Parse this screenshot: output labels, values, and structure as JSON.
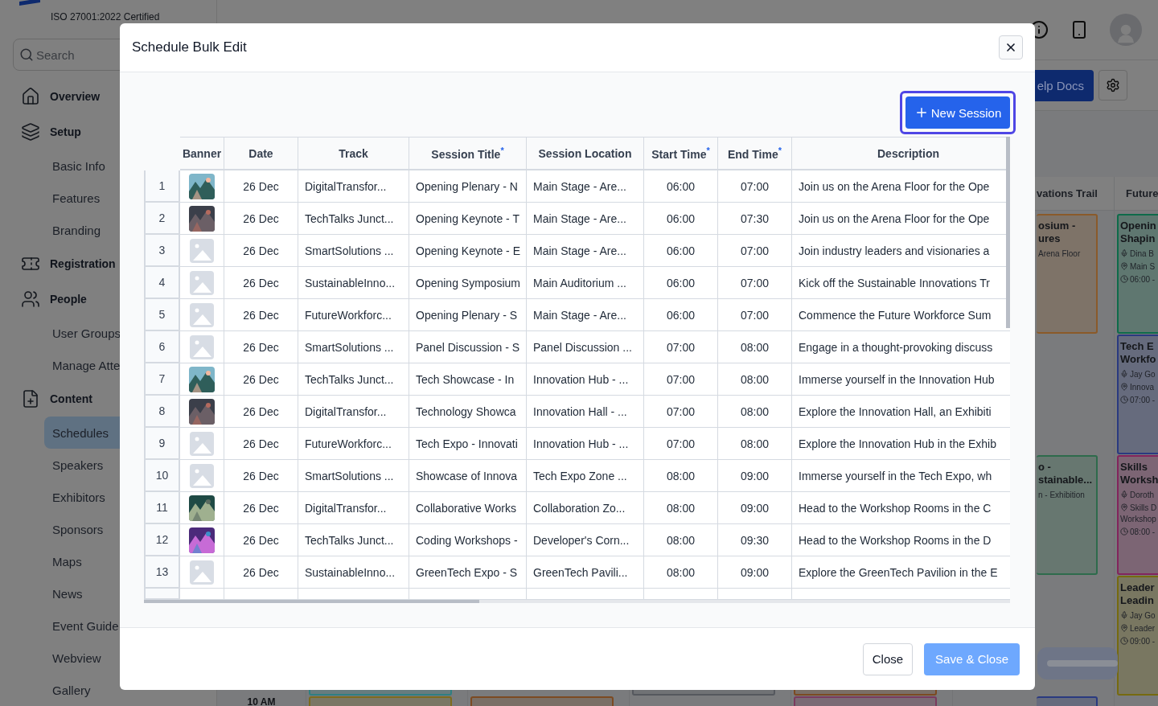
{
  "sidebar": {
    "certification": "ISO 27001:2022 Certified",
    "search": {
      "placeholder": "Search"
    },
    "nav": [
      {
        "label": "Overview",
        "selected": false
      },
      {
        "label": "Setup",
        "selected": false,
        "children": [
          {
            "label": "Basic Info",
            "selected": false
          },
          {
            "label": "Features",
            "selected": false
          },
          {
            "label": "Branding",
            "selected": false
          }
        ]
      },
      {
        "label": "Registration",
        "selected": false
      },
      {
        "label": "People",
        "selected": false,
        "children": [
          {
            "label": "User Groups",
            "selected": false
          },
          {
            "label": "Manage Atte",
            "selected": false
          }
        ]
      },
      {
        "label": "Content",
        "selected": false,
        "children": [
          {
            "label": "Schedules",
            "selected": true
          },
          {
            "label": "Speakers",
            "selected": false
          },
          {
            "label": "Exhibitors",
            "selected": false
          },
          {
            "label": "Sponsors",
            "selected": false
          },
          {
            "label": "Maps",
            "selected": false
          },
          {
            "label": "News",
            "selected": false
          },
          {
            "label": "Event Guide",
            "selected": false
          },
          {
            "label": "Webview",
            "selected": false
          },
          {
            "label": "Gallery",
            "selected": false
          }
        ]
      }
    ]
  },
  "toolbar": {
    "help_button": "elp Docs"
  },
  "calendar": {
    "time_labels": [
      "10 AM"
    ],
    "columns": [
      {
        "slots": [
          {
            "kind": "gap"
          },
          {
            "kind": "gap"
          },
          {
            "kind": "gap"
          },
          {
            "kind": "card",
            "color": "#2f7f82"
          },
          {
            "kind": "card",
            "color": "#7d6b1e"
          }
        ]
      },
      {
        "slots": [
          {
            "kind": "gap"
          },
          {
            "kind": "gap"
          },
          {
            "kind": "gap"
          },
          {
            "kind": "gap"
          },
          {
            "kind": "card",
            "color": "#7c4a22"
          }
        ]
      },
      {
        "slots": [
          {
            "kind": "gap"
          },
          {
            "kind": "gap"
          },
          {
            "kind": "gap"
          },
          {
            "kind": "card",
            "color": "#55585e"
          }
        ]
      },
      {
        "slots": [
          {
            "kind": "gap"
          },
          {
            "kind": "gap"
          },
          {
            "kind": "gap"
          },
          {
            "kind": "card",
            "color": "#7c4a22"
          },
          {
            "kind": "card",
            "color": "#7a3a5e"
          }
        ]
      },
      {
        "header": "vations Trail",
        "partial": true,
        "slots": [
          {
            "kind": "card",
            "color": "#8a5a2a",
            "title": "osium -\nures",
            "location": "Arena Floor"
          },
          {
            "kind": "gap"
          },
          {
            "kind": "card",
            "color": "#2e6b4c",
            "title": "o -\nstainable...",
            "location": "n - Exhibition"
          },
          {
            "kind": "gap"
          },
          {
            "kind": "card",
            "color": "#2a3a80"
          }
        ]
      },
      {
        "header": "Future",
        "partial": false,
        "slots": [
          {
            "kind": "card",
            "color": "#0e6b4a",
            "title": "Openin\nShapin",
            "speaker": "Dina B",
            "location": "Main S",
            "time": "06:00 -"
          },
          {
            "kind": "card",
            "color": "#2a3a80",
            "title": "Tech E\nWorkfo",
            "speaker": "Jay Go",
            "location": "Innova",
            "time": "07:00 -"
          },
          {
            "kind": "card",
            "color": "#82245c",
            "title": "Skills\nWorksh",
            "speaker": "Doroth",
            "location": "Skills D\nWorkshop",
            "time": "08:00 -"
          },
          {
            "kind": "card",
            "color": "#766a10",
            "title": "Leader\nLeadin",
            "speaker": "Jay Go",
            "location": "Leader",
            "time": "09:00 -"
          }
        ]
      }
    ]
  },
  "modal": {
    "title": "Schedule Bulk Edit",
    "new_button": {
      "label": "New Session",
      "focused": true
    },
    "table": {
      "columns": [
        {
          "label": "Banner"
        },
        {
          "label": "Date"
        },
        {
          "label": "Track"
        },
        {
          "label": "Session Title$^{*}$"
        },
        {
          "label": "Session Location"
        },
        {
          "label": "Start Time$^{*}$"
        },
        {
          "label": "End Time$^{*}$"
        },
        {
          "label": "Description"
        }
      ],
      "rows": [
        {
          "number": "1",
          "date": "26 Dec",
          "track": "DigitalTransfor...",
          "title": "Opening Plenary - N",
          "location": "Main Stage - Are...",
          "start": "06:00",
          "end": "07:00",
          "description": "Join us on the Arena Floor for the Ope"
        },
        {
          "number": "2",
          "date": "26 Dec",
          "track": "TechTalks Junct...",
          "title": "Opening Keynote - T",
          "location": "Main Stage - Are...",
          "start": "06:00",
          "end": "07:30",
          "description": "Join us on the Arena Floor for the Ope"
        },
        {
          "number": "3",
          "banner": {
            "kind": "placeholder"
          },
          "date": "26 Dec",
          "track": "SmartSolutions ...",
          "title": "Opening Keynote - E",
          "location": "Main Stage - Are...",
          "start": "06:00",
          "end": "07:00",
          "description": "Join industry leaders and visionaries a"
        },
        {
          "number": "4",
          "banner": {
            "kind": "placeholder"
          },
          "date": "26 Dec",
          "track": "SustainableInno...",
          "title": "Opening Symposium",
          "location": "Main Auditorium ...",
          "start": "06:00",
          "end": "07:00",
          "description": "Kick off the Sustainable Innovations Tr"
        },
        {
          "number": "5",
          "banner": {
            "kind": "placeholder"
          },
          "date": "26 Dec",
          "track": "FutureWorkforc...",
          "title": "Opening Plenary - S",
          "location": "Main Stage - Are...",
          "start": "06:00",
          "end": "07:00",
          "description": "Commence the Future Workforce Sum"
        },
        {
          "number": "6",
          "banner": {
            "kind": "placeholder"
          },
          "date": "26 Dec",
          "track": "SmartSolutions ...",
          "title": "Panel Discussion - S",
          "location": "Panel Discussion ...",
          "start": "07:00",
          "end": "08:00",
          "description": "Engage in a thought-provoking discuss"
        },
        {
          "number": "7",
          "date": "26 Dec",
          "track": "TechTalks Junct...",
          "title": "Tech Showcase - In",
          "location": "Innovation Hub - ...",
          "start": "07:00",
          "end": "08:00",
          "description": "Immerse yourself in the Innovation Hub"
        },
        {
          "number": "8",
          "date": "26 Dec",
          "track": "DigitalTransfor...",
          "title": "Technology Showca",
          "location": "Innovation Hall - ...",
          "start": "07:00",
          "end": "08:00",
          "description": "Explore the Innovation Hall, an Exhibiti"
        },
        {
          "number": "9",
          "banner": {
            "kind": "placeholder"
          },
          "date": "26 Dec",
          "track": "FutureWorkforc...",
          "title": "Tech Expo - Innovati",
          "location": "Innovation Hub - ...",
          "start": "07:00",
          "end": "08:00",
          "description": "Explore the Innovation Hub in the Exhib"
        },
        {
          "number": "10",
          "banner": {
            "kind": "placeholder"
          },
          "date": "26 Dec",
          "track": "SmartSolutions ...",
          "title": "Showcase of Innova",
          "location": "Tech Expo Zone ...",
          "start": "08:00",
          "end": "09:00",
          "description": "Immerse yourself in the Tech Expo, wh"
        },
        {
          "number": "11",
          "date": "26 Dec",
          "track": "DigitalTransfor...",
          "title": "Collaborative Works",
          "location": "Collaboration Zo...",
          "start": "08:00",
          "end": "09:00",
          "description": "Head to the Workshop Rooms in the C"
        },
        {
          "number": "12",
          "date": "26 Dec",
          "track": "TechTalks Junct...",
          "title": "Coding Workshops -",
          "location": "Developer's Corn...",
          "start": "08:00",
          "end": "09:30",
          "description": "Head to the Workshop Rooms in the D"
        },
        {
          "number": "13",
          "banner": {
            "kind": "placeholder"
          },
          "date": "26 Dec",
          "track": "SustainableInno...",
          "title": "GreenTech Expo - S",
          "location": "GreenTech Pavili...",
          "start": "08:00",
          "end": "09:00",
          "description": "Explore the GreenTech Pavilion in the E"
        }
      ]
    },
    "footer": {
      "close": "Close",
      "save": {
        "label": "Save & Close",
        "disabled": true
      }
    }
  }
}
